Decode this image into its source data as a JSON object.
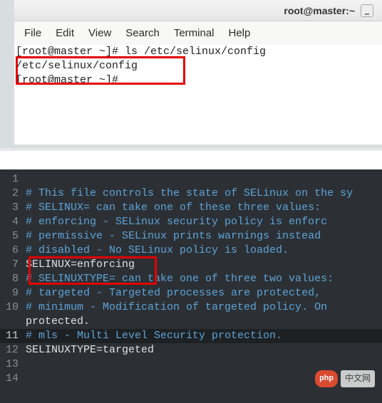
{
  "window": {
    "title": "root@master:~",
    "min_glyph": "–"
  },
  "menu": {
    "file": "File",
    "edit": "Edit",
    "view": "View",
    "search": "Search",
    "terminal": "Terminal",
    "help": "Help"
  },
  "terminal": {
    "line1": "[root@master ~]# ls /etc/selinux/config",
    "line2": "/etc/selinux/config",
    "line3": "[root@master ~]#"
  },
  "editor": {
    "lines": [
      {
        "n": 1,
        "text": "",
        "comment": false
      },
      {
        "n": 2,
        "text": "# This file controls the state of SELinux on the sy",
        "comment": true
      },
      {
        "n": 3,
        "text": "# SELINUX= can take one of these three values:",
        "comment": true
      },
      {
        "n": 4,
        "text": "#     enforcing - SELinux security policy is enforc",
        "comment": true
      },
      {
        "n": 5,
        "text": "#     permissive - SELinux prints warnings instead ",
        "comment": true
      },
      {
        "n": 6,
        "text": "#     disabled - No SELinux policy is loaded.",
        "comment": true
      },
      {
        "n": 7,
        "text": "SELINUX=enforcing",
        "comment": false
      },
      {
        "n": 8,
        "text": "# SELINUXTYPE= can take one of three two values:",
        "comment": true
      },
      {
        "n": 9,
        "text": "#     targeted - Targeted processes are protected,",
        "comment": true
      },
      {
        "n": 10,
        "text": "#     minimum - Modification of targeted policy. On",
        "comment": true
      },
      {
        "n": -1,
        "text": "protected.",
        "comment": false,
        "continuation": true
      },
      {
        "n": 11,
        "text": "#     mls - Multi Level Security protection.",
        "comment": true,
        "active": true
      },
      {
        "n": 12,
        "text": "SELINUXTYPE=targeted",
        "comment": false
      },
      {
        "n": 13,
        "text": "",
        "comment": false
      },
      {
        "n": 14,
        "text": "",
        "comment": false
      }
    ]
  },
  "watermark": {
    "logo": "php",
    "text": "中文网"
  }
}
